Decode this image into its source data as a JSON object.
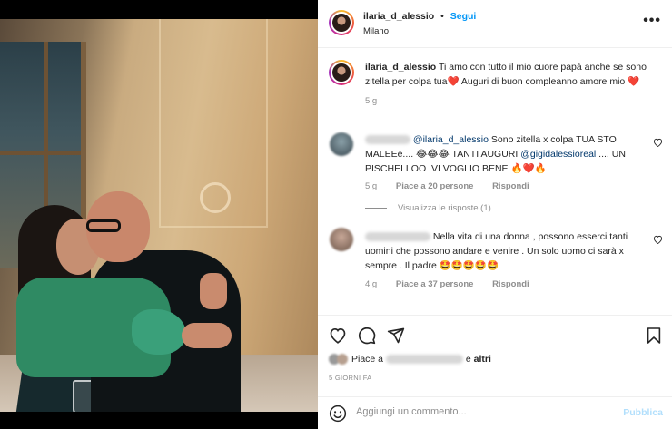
{
  "header": {
    "username": "ilaria_d_alessio",
    "dot": "•",
    "follow_label": "Segui",
    "location": "Milano",
    "more_label": "•••"
  },
  "caption": {
    "username": "ilaria_d_alessio",
    "text": "Ti amo con tutto il mio cuore papà anche se sono zitella per colpa tua❤️ Auguri di buon compleanno amore mio ❤️",
    "time": "5 g"
  },
  "comments": [
    {
      "mention": "@ilaria_d_alessio",
      "text1": " Sono zitella x colpa TUA STO MALEEe.... 😂😂😂 TANTI AUGURI ",
      "mention2": "@gigidalessioreal",
      "text2": " .... UN PISCHELLOO ,VI VOGLIO BENE 🔥❤️🔥",
      "time": "5 g",
      "likes": "Piace a 20 persone",
      "reply": "Rispondi",
      "view_replies": "Visualizza le risposte (1)"
    },
    {
      "text": "Nella vita di una donna , possono esserci tanti uomini che possono andare e venire . Un solo uomo ci sarà x sempre . Il padre 🤩🤩🤩🤩🤩",
      "time": "4 g",
      "likes": "Piace a 37 persone",
      "reply": "Rispondi"
    }
  ],
  "likes_line": {
    "prefix": "Piace a",
    "suffix": "e",
    "others": "altri"
  },
  "post_date": "5 GIORNI FA",
  "add_comment": {
    "placeholder": "Aggiungi un commento...",
    "publish_label": "Pubblica"
  },
  "icons": {
    "like": "heart-icon",
    "comment": "comment-icon",
    "share": "paper-plane-icon",
    "save": "bookmark-icon",
    "emoji": "smiley-icon"
  }
}
